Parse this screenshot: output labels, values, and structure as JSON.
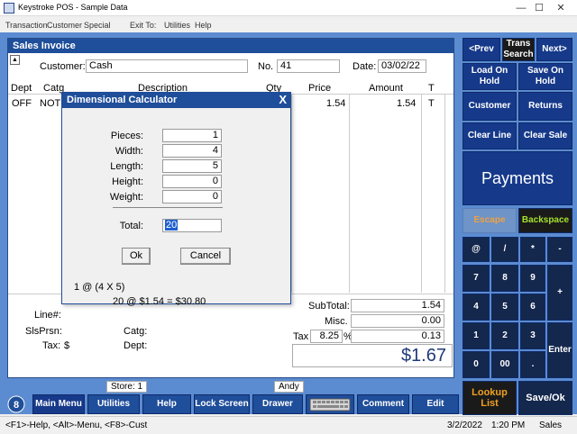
{
  "window": {
    "title": "Keystroke POS - Sample Data",
    "minimize": "—",
    "maximize": "☐",
    "close": "✕"
  },
  "menu": [
    "Transaction",
    "Customer",
    "Special",
    "Exit To:",
    "Utilities",
    "Help"
  ],
  "invoice": {
    "title": "Sales Invoice",
    "customer_label": "Customer:",
    "customer_value": "Cash",
    "no_label": "No.",
    "no_value": "41",
    "date_label": "Date:",
    "date_value": "03/02/22",
    "columns": [
      "Dept",
      "Catg",
      "Description",
      "Qty",
      "Price",
      "Amount",
      "T"
    ],
    "row": {
      "dept": "OFF",
      "catg": "NOTE",
      "price": "1.54",
      "amount": "1.54",
      "t": "T"
    },
    "lineno_label": "Line#:",
    "slsprsn_label": "SlsPrsn:",
    "tax_label": "Tax:",
    "tax_symbol": "$",
    "catg_label": "Catg:",
    "dept_label": "Dept:",
    "subtotal_label": "SubTotal:",
    "subtotal_value": "1.54",
    "misc_label": "Misc.",
    "misc_value": "0.00",
    "tax2_label": "Tax",
    "tax_rate": "8.25",
    "tax_percent": "%",
    "tax_value": "0.13",
    "total": "$1.67"
  },
  "dialog": {
    "title": "Dimensional Calculator",
    "close": "X",
    "fields": [
      {
        "label": "Pieces:",
        "value": "1"
      },
      {
        "label": "Width:",
        "value": "4"
      },
      {
        "label": "Length:",
        "value": "5"
      },
      {
        "label": "Height:",
        "value": "0"
      },
      {
        "label": "Weight:",
        "value": "0"
      }
    ],
    "total_label": "Total:",
    "total_value": "20",
    "ok": "Ok",
    "cancel": "Cancel",
    "formula1": "1 @ (4 X 5)",
    "formula2": "20 @ $1.54 = $30.80"
  },
  "right_panel": {
    "prev": "<Prev",
    "trans_search": "Trans Search",
    "next": "Next>",
    "load_on_hold": "Load On Hold",
    "save_on_hold": "Save On Hold",
    "customer": "Customer",
    "returns": "Returns",
    "clear_line": "Clear Line",
    "clear_sale": "Clear Sale",
    "payments": "Payments",
    "escape": "Escape",
    "backspace": "Backspace",
    "keys": [
      "@",
      "/",
      "*",
      "-",
      "7",
      "8",
      "9",
      "+",
      "4",
      "5",
      "6",
      "1",
      "2",
      "3",
      "Enter",
      "0",
      "00",
      "."
    ],
    "lookup_list": "Lookup List",
    "save_ok": "Save/Ok"
  },
  "toolbar": {
    "store_label": "Store: 1",
    "user_label": "Andy",
    "main_menu": "Main Menu",
    "utilities": "Utilities",
    "help": "Help",
    "lock_screen": "Lock Screen",
    "drawer": "Drawer",
    "comment": "Comment",
    "edit": "Edit"
  },
  "status": {
    "hints": "<F1>-Help, <Alt>-Menu, <F8>-Cust",
    "date": "3/2/2022",
    "time": "1:20 PM",
    "mode": "Sales"
  }
}
